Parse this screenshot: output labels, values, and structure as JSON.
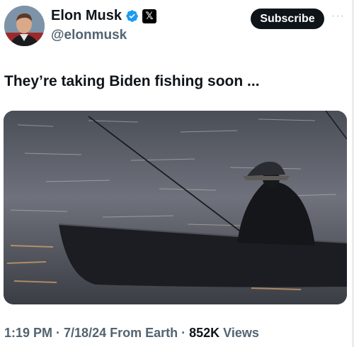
{
  "author": {
    "name": "Elon Musk",
    "handle": "@elonmusk",
    "verified_icon": "verified-badge-icon",
    "affiliate_icon": "x-logo-icon",
    "affiliate_glyph": "𝕏"
  },
  "actions": {
    "subscribe_label": "Subscribe",
    "more_label": "···"
  },
  "tweet": {
    "text": "They’re taking Biden fishing soon ..."
  },
  "media": {
    "type": "photo",
    "subject": "silhouette of a fisherman in a rowboat on water at dusk"
  },
  "meta": {
    "time": "1:19 PM",
    "sep1": " · ",
    "date": "7/18/24",
    "source": " From Earth",
    "sep2": " · ",
    "views_count": "852K",
    "views_label": " Views"
  },
  "colors": {
    "verified": "#1d9bf0",
    "text_primary": "#0f1419",
    "text_secondary": "#536471",
    "button_bg": "#0f1419"
  }
}
